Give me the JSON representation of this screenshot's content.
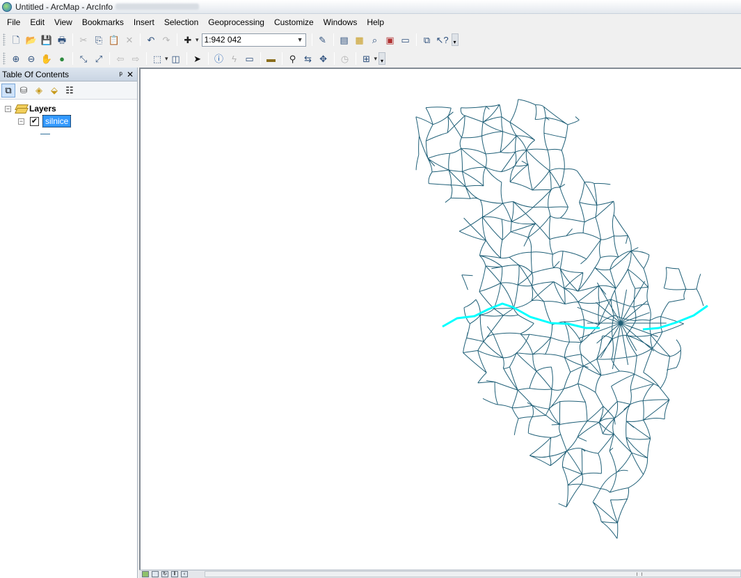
{
  "window": {
    "title": "Untitled - ArcMap - ArcInfo"
  },
  "menu": [
    "File",
    "Edit",
    "View",
    "Bookmarks",
    "Insert",
    "Selection",
    "Geoprocessing",
    "Customize",
    "Windows",
    "Help"
  ],
  "toolbar": {
    "scale": "1:942 042",
    "icons_row1": [
      "new-document-icon",
      "open-icon",
      "save-icon",
      "print-icon",
      "cut-icon",
      "copy-icon",
      "paste-icon",
      "delete-icon",
      "undo-icon",
      "redo-icon",
      "add-data-icon"
    ],
    "icons_row1_after": [
      "editor-icon",
      "table-of-contents-icon",
      "catalog-icon",
      "search-icon",
      "arctoolbox-icon",
      "python-icon",
      "model-builder-icon",
      "whats-this-icon"
    ],
    "icons_row2": [
      "zoom-in-icon",
      "zoom-out-icon",
      "pan-icon",
      "full-extent-icon",
      "fixed-zoom-in-icon",
      "fixed-zoom-out-icon",
      "back-extent-icon",
      "forward-extent-icon",
      "select-features-icon",
      "clear-selection-icon",
      "select-elements-icon",
      "identify-icon",
      "hyperlink-icon",
      "html-popup-icon",
      "measure-icon",
      "find-icon",
      "find-route-icon",
      "go-to-xy-icon",
      "time-slider-icon",
      "viewer-window-icon"
    ]
  },
  "toc": {
    "title": "Table Of Contents",
    "pin": "ᵖ",
    "close": "✕",
    "root_label": "Layers",
    "layer_label": "silnice",
    "layer_checked": true
  },
  "map": {
    "road_color": "#1f5f77",
    "highlight_color": "#00ffff",
    "background": "#ffffff"
  }
}
